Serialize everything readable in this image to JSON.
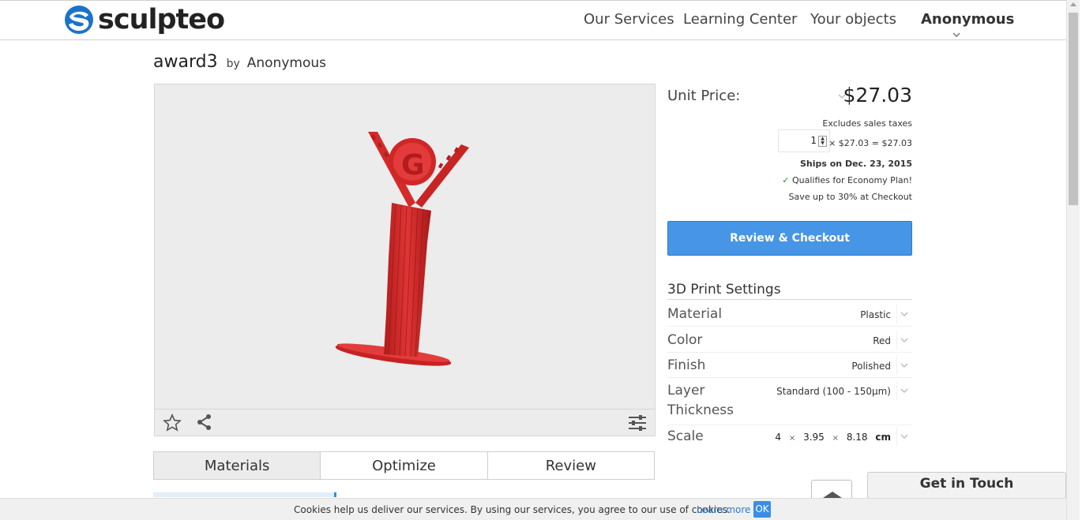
{
  "header": {
    "logo_text": "sculpteo",
    "nav": [
      "Our Services",
      "Learning Center",
      "Your objects"
    ],
    "user": "Anonymous"
  },
  "product": {
    "name": "award3",
    "by": "by",
    "author": "Anonymous"
  },
  "pricing": {
    "unit_price_label": "Unit Price:",
    "unit_price": "$27.03",
    "tax_note": "Excludes sales taxes",
    "quantity": "1",
    "calc": "× $27.03 = $27.03",
    "ships": "Ships on Dec. 23, 2015",
    "economy_check": "✓",
    "economy": "Qualifies for Economy Plan!",
    "save": "Save up to 30% at Checkout",
    "checkout_label": "Review & Checkout"
  },
  "settings": {
    "title": "3D Print Settings",
    "material": {
      "label": "Material",
      "value": "Plastic"
    },
    "color": {
      "label": "Color",
      "value": "Red"
    },
    "finish": {
      "label": "Finish",
      "value": "Polished"
    },
    "layer": {
      "label_1": "Layer",
      "label_2": "Thickness",
      "value": "Standard (100 - 150µm)"
    },
    "scale": {
      "label": "Scale",
      "x": "4",
      "y": "3.95",
      "z": "8.18",
      "sep": "×",
      "unit": "cm"
    }
  },
  "tabs": [
    "Materials",
    "Optimize",
    "Review"
  ],
  "get_in_touch": "Get in Touch",
  "cookie": {
    "text": "Cookies help us deliver our services. By using our services, you agree to our use of cookies.",
    "learn_more": "Learn more",
    "ok": "OK"
  },
  "colors": {
    "brand_blue": "#1a73c8",
    "checkout_blue": "#4795e6",
    "model_red": "#d42a2a"
  },
  "icons": [
    "star-icon",
    "share-icon",
    "sliders-icon",
    "chevron-down-icon",
    "check-icon",
    "arrow-up-icon"
  ]
}
